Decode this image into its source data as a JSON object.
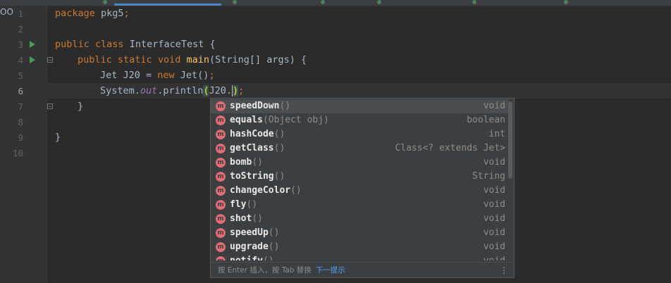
{
  "editor": {
    "left_edge_text": "OO",
    "line_numbers": [
      "1",
      "2",
      "3",
      "4",
      "5",
      "6",
      "7",
      "8",
      "9",
      "10"
    ],
    "current_line": "6",
    "code": {
      "l1_kw": "package",
      "l1_rest": " pkg5",
      "l1_semi": ";",
      "l3_kw1": "public",
      "l3_kw2": "class",
      "l3_name": "InterfaceTest",
      "l3_rest": " {",
      "l4_kw1": "public",
      "l4_kw2": "static",
      "l4_kw3": "void",
      "l4_fn": "main",
      "l4_rest": "(String[] args) {",
      "l5_pre": "Jet J20 = ",
      "l5_kw": "new",
      "l5_rest": " Jet()",
      "l5_semi": ";",
      "l6_pre": "System.",
      "l6_fld": "out",
      "l6_mid": ".println",
      "l6_paren_open": "(",
      "l6_arg": "J20.",
      "l6_paren_close": ")",
      "l6_semi": ";",
      "l7": "}",
      "l9": "}"
    }
  },
  "completion": {
    "icon_letter": "m",
    "items": [
      {
        "name": "speedDown",
        "params": "()",
        "type": "void"
      },
      {
        "name": "equals",
        "params": "(Object obj)",
        "type": "boolean"
      },
      {
        "name": "hashCode",
        "params": "()",
        "type": "int"
      },
      {
        "name": "getClass",
        "params": "()",
        "type": "Class<? extends Jet>"
      },
      {
        "name": "bomb",
        "params": "()",
        "type": "void"
      },
      {
        "name": "toString",
        "params": "()",
        "type": "String"
      },
      {
        "name": "changeColor",
        "params": "()",
        "type": "void"
      },
      {
        "name": "fly",
        "params": "()",
        "type": "void"
      },
      {
        "name": "shot",
        "params": "()",
        "type": "void"
      },
      {
        "name": "speedUp",
        "params": "()",
        "type": "void"
      },
      {
        "name": "upgrade",
        "params": "()",
        "type": "void"
      },
      {
        "name": "notify",
        "params": "()",
        "type": "void"
      }
    ],
    "footer_hint": "按 Enter 插入，按 Tab 替换",
    "footer_link": "下一提示",
    "footer_menu": "⋮"
  }
}
